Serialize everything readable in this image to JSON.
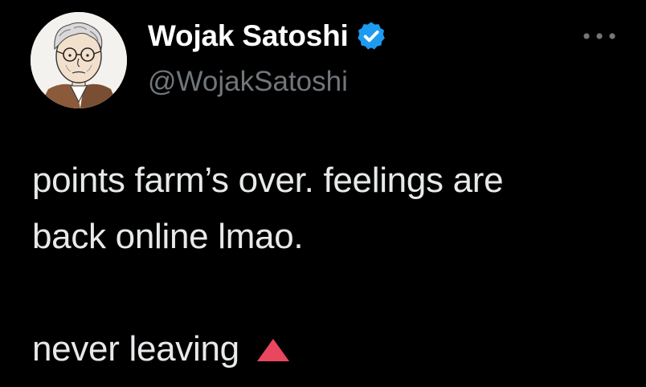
{
  "tweet": {
    "author": {
      "display_name": "Wojak Satoshi",
      "handle": "@WojakSatoshi",
      "verified": true,
      "avatar": "wojak-avatar"
    },
    "more_icon": "more-horizontal-icon",
    "text_lines": [
      "points farm’s over. feelings are",
      "back online lmao."
    ],
    "closing_line": "never leaving",
    "closing_icon": "red-triangle-up-icon"
  },
  "colors": {
    "background": "#000000",
    "primary_text": "#e7e9ea",
    "secondary_text": "#71767b",
    "verified_blue": "#1d9bf0",
    "triangle_red": "#e8475f"
  }
}
